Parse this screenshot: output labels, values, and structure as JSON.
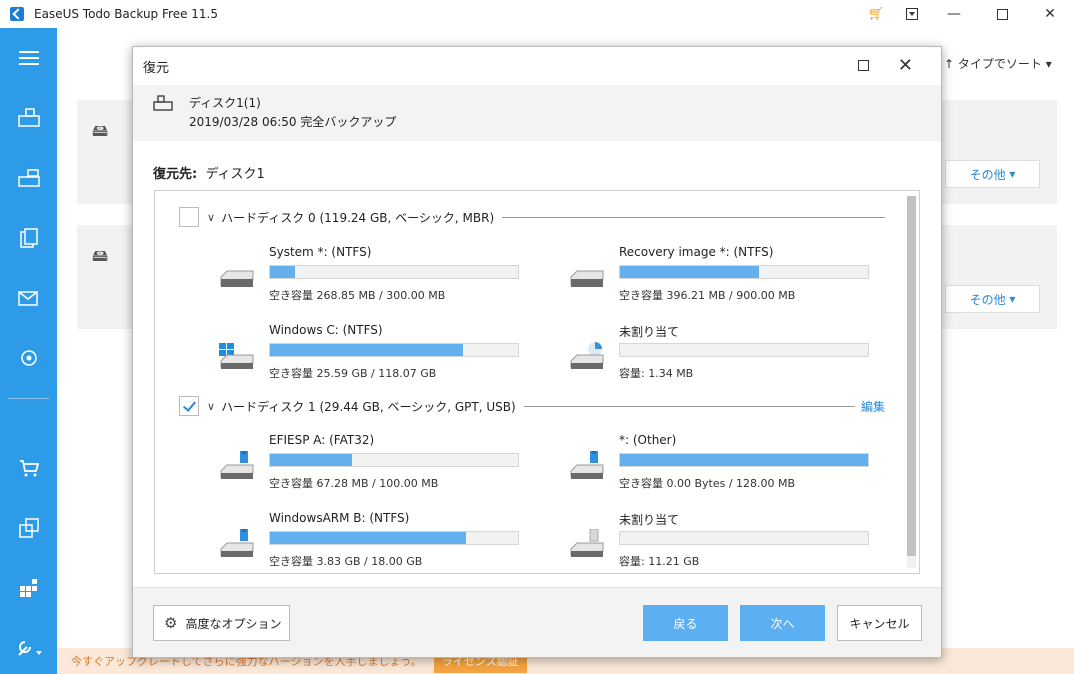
{
  "app": {
    "title": "EaseUS Todo Backup Free 11.5"
  },
  "background": {
    "sort_label": "タイプでソート",
    "more_label_1": "その他",
    "more_label_2": "その他",
    "banner_text": "今すぐアップグレードしてさらに強力なバージョンを入手しましょう。",
    "banner_button": "ライセンス認証"
  },
  "dialog": {
    "title": "復元",
    "source": {
      "name": "ディスク1(1)",
      "date": "2019/03/28 06:50 完全バックアップ"
    },
    "dest_label": "復元先:",
    "dest_value": "ディスク1",
    "disks": [
      {
        "label": "ハードディスク 0 (119.24 GB, ベーシック, MBR)",
        "checked": false,
        "partitions": [
          {
            "name": "System *: (NTFS)",
            "info": "空き容量 268.85 MB / 300.00 MB",
            "used_fraction": 0.1,
            "icon": "hdd-icon"
          },
          {
            "name": "Recovery image *: (NTFS)",
            "info": "空き容量 396.21 MB / 900.00 MB",
            "used_fraction": 0.56,
            "icon": "hdd-icon"
          },
          {
            "name": "Windows C: (NTFS)",
            "info": "空き容量 25.59 GB / 118.07 GB",
            "used_fraction": 0.78,
            "icon": "windows-drive-icon"
          },
          {
            "name": "未割り当て",
            "info": "容量: 1.34 MB",
            "used_fraction": 0.0,
            "icon": "unallocated-icon"
          }
        ]
      },
      {
        "label": "ハードディスク 1 (29.44 GB, ベーシック, GPT, USB)",
        "checked": true,
        "edit_label": "編集",
        "partitions": [
          {
            "name": "EFIESP A: (FAT32)",
            "info": "空き容量 67.28 MB / 100.00 MB",
            "used_fraction": 0.33,
            "icon": "usb-drive-icon"
          },
          {
            "name": "*: (Other)",
            "info": "空き容量 0.00 Bytes / 128.00 MB",
            "used_fraction": 1.0,
            "icon": "usb-drive-icon"
          },
          {
            "name": "WindowsARM B: (NTFS)",
            "info": "空き容量 3.83 GB / 18.00 GB",
            "used_fraction": 0.79,
            "icon": "usb-drive-icon"
          },
          {
            "name": "未割り当て",
            "info": "容量: 11.21 GB",
            "used_fraction": 0.0,
            "icon": "usb-drive-gray-icon"
          }
        ]
      }
    ],
    "footer": {
      "advanced_label": "高度なオプション",
      "back_label": "戻る",
      "next_label": "次へ",
      "cancel_label": "キャンセル"
    }
  },
  "colors": {
    "accent": "#2e9be8",
    "bar_fill": "#62b1ee",
    "link": "#2a88d8"
  }
}
